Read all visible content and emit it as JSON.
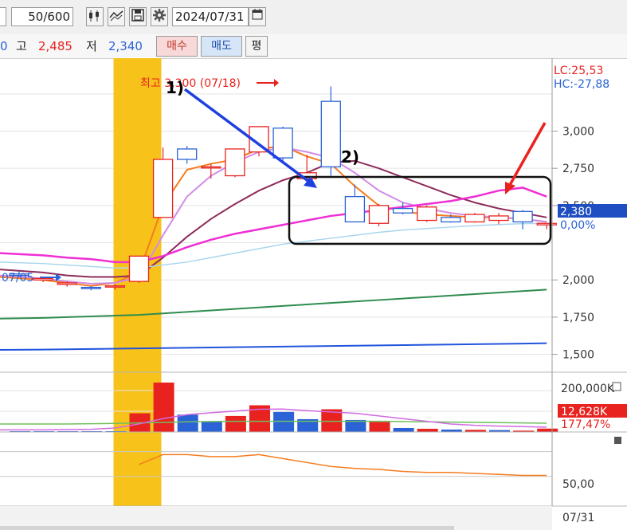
{
  "toolbar": {
    "count_value": "50",
    "count_total": "/600",
    "date_value": "2024/07/31"
  },
  "quote": {
    "fragment": "0",
    "high_label": "고",
    "high_value": "2,485",
    "low_label": "저",
    "low_value": "2,340",
    "buy_label": "매수",
    "sell_label": "매도",
    "avg_label": "평"
  },
  "price_axis": {
    "lc_label": "LC:25,53",
    "hc_label": "HC:-27,88",
    "ticks": [
      "3,000",
      "2,750",
      "2,500",
      "2,000",
      "1,750",
      "1,500"
    ],
    "current_price": "2,380",
    "current_pct": "0,00%"
  },
  "volume_axis": {
    "max_label": "200,000K",
    "current_volume": "12,628K",
    "current_pct": "177,47%"
  },
  "indicator_axis": {
    "tick": "50,00"
  },
  "date_axis": {
    "end_date": "07/31"
  },
  "annotations": {
    "high_note": "최고 3,300 (07/18)",
    "low_note": "07/05",
    "label_1": "1)",
    "label_2": "2)"
  },
  "colors": {
    "up": "#e8231f",
    "down": "#2b62d6",
    "highlight": "#f7c21a",
    "ma_orange": "#f57c1f",
    "ma_violet": "#d18be6",
    "ma_maroon": "#8e2c5b",
    "ma_magenta": "#ef2fd4",
    "ma_lightblue": "#a9d6ee",
    "ma_green": "#2f8c4e",
    "ma_blue": "#2255dd"
  },
  "chart_data": {
    "type": "candlestick",
    "ylim": [
      1380,
      3490
    ],
    "candles": [
      {
        "x": 0,
        "o": 2040,
        "h": 2060,
        "l": 2020,
        "c": 2030
      },
      {
        "x": 1,
        "o": 2000,
        "h": 2020,
        "l": 1985,
        "c": 2010
      },
      {
        "x": 2,
        "o": 1970,
        "h": 1990,
        "l": 1955,
        "c": 1980
      },
      {
        "x": 3,
        "o": 1950,
        "h": 1960,
        "l": 1930,
        "c": 1945
      },
      {
        "x": 4,
        "o": 1960,
        "h": 1970,
        "l": 1935,
        "c": 1960
      },
      {
        "x": 5,
        "o": 1990,
        "h": 2160,
        "l": 1980,
        "c": 2160
      },
      {
        "x": 6,
        "o": 2420,
        "h": 2890,
        "l": 2420,
        "c": 2810
      },
      {
        "x": 7,
        "o": 2880,
        "h": 2900,
        "l": 2780,
        "c": 2810
      },
      {
        "x": 8,
        "o": 2760,
        "h": 2780,
        "l": 2680,
        "c": 2760
      },
      {
        "x": 9,
        "o": 2700,
        "h": 2880,
        "l": 2690,
        "c": 2880
      },
      {
        "x": 10,
        "o": 2860,
        "h": 3030,
        "l": 2830,
        "c": 3030
      },
      {
        "x": 11,
        "o": 3020,
        "h": 3030,
        "l": 2780,
        "c": 2820
      },
      {
        "x": 12,
        "o": 2680,
        "h": 2840,
        "l": 2660,
        "c": 2720
      },
      {
        "x": 13,
        "o": 3200,
        "h": 3300,
        "l": 2700,
        "c": 2760
      },
      {
        "x": 14,
        "o": 2560,
        "h": 2640,
        "l": 2390,
        "c": 2390
      },
      {
        "x": 15,
        "o": 2380,
        "h": 2510,
        "l": 2360,
        "c": 2500
      },
      {
        "x": 16,
        "o": 2480,
        "h": 2520,
        "l": 2440,
        "c": 2450
      },
      {
        "x": 17,
        "o": 2400,
        "h": 2500,
        "l": 2390,
        "c": 2490
      },
      {
        "x": 18,
        "o": 2420,
        "h": 2440,
        "l": 2385,
        "c": 2390
      },
      {
        "x": 19,
        "o": 2390,
        "h": 2450,
        "l": 2385,
        "c": 2440
      },
      {
        "x": 20,
        "o": 2400,
        "h": 2450,
        "l": 2375,
        "c": 2430
      },
      {
        "x": 21,
        "o": 2460,
        "h": 2470,
        "l": 2340,
        "c": 2390
      },
      {
        "x": 22,
        "o": 2370,
        "h": 2380,
        "l": 2340,
        "c": 2380
      }
    ],
    "moving_averages": [
      {
        "name": "ma_orange",
        "values": [
          2020,
          2000,
          1980,
          1960,
          1980,
          2050,
          2500,
          2740,
          2780,
          2810,
          2880,
          2900,
          2830,
          2780,
          2630,
          2500,
          2460,
          2440,
          2430,
          2420,
          2420,
          2410,
          2390
        ]
      },
      {
        "name": "ma_violet",
        "values": [
          2030,
          2010,
          1990,
          1975,
          1980,
          2020,
          2300,
          2560,
          2700,
          2790,
          2860,
          2890,
          2860,
          2820,
          2720,
          2600,
          2520,
          2480,
          2450,
          2430,
          2420,
          2410,
          2390
        ]
      },
      {
        "name": "ma_maroon",
        "values": [
          2070,
          2050,
          2030,
          2020,
          2020,
          2030,
          2150,
          2290,
          2410,
          2510,
          2600,
          2670,
          2720,
          2790,
          2800,
          2750,
          2690,
          2630,
          2570,
          2520,
          2480,
          2450,
          2420
        ]
      },
      {
        "name": "ma_magenta",
        "values": [
          2180,
          2165,
          2150,
          2140,
          2120,
          2120,
          2160,
          2220,
          2270,
          2310,
          2340,
          2370,
          2400,
          2430,
          2450,
          2470,
          2490,
          2510,
          2530,
          2560,
          2600,
          2620,
          2560
        ]
      },
      {
        "name": "ma_lightblue",
        "values": [
          2120,
          2110,
          2100,
          2090,
          2080,
          2080,
          2100,
          2120,
          2150,
          2180,
          2210,
          2240,
          2260,
          2280,
          2300,
          2320,
          2335,
          2345,
          2355,
          2365,
          2372,
          2378,
          2380
        ]
      },
      {
        "name": "ma_green",
        "values": [
          1740,
          1745,
          1750,
          1755,
          1760,
          1765,
          1775,
          1785,
          1795,
          1805,
          1815,
          1825,
          1835,
          1845,
          1855,
          1865,
          1875,
          1885,
          1895,
          1905,
          1915,
          1925,
          1935
        ]
      },
      {
        "name": "ma_blue",
        "values": [
          1530,
          1532,
          1534,
          1536,
          1538,
          1540,
          1542,
          1544,
          1546,
          1548,
          1550,
          1552,
          1554,
          1556,
          1558,
          1560,
          1562,
          1564,
          1566,
          1568,
          1570,
          1572,
          1575
        ]
      }
    ],
    "volume": {
      "ylim": [
        0,
        200000
      ],
      "values": [
        3000,
        3000,
        3000,
        3000,
        3000,
        70000,
        185000,
        65000,
        38000,
        60000,
        100000,
        75000,
        48000,
        85000,
        45000,
        38000,
        15000,
        12000,
        9000,
        8000,
        7000,
        5000,
        12628
      ],
      "up": [
        false,
        false,
        false,
        false,
        false,
        true,
        true,
        false,
        false,
        true,
        true,
        false,
        false,
        true,
        false,
        true,
        false,
        true,
        false,
        true,
        false,
        true,
        true
      ],
      "ma_violet": [
        8000,
        8000,
        9000,
        10000,
        15000,
        30000,
        50000,
        65000,
        72000,
        78000,
        85000,
        86000,
        80000,
        75000,
        70000,
        60000,
        50000,
        40000,
        30000,
        25000,
        22000,
        20000,
        18000
      ],
      "ma_green": [
        30000,
        30000,
        30000,
        31000,
        32000,
        34000,
        36000,
        38000,
        39000,
        40000,
        40000,
        40000,
        40000,
        40000,
        40000,
        40000,
        39000,
        38000,
        37000,
        36000,
        35000,
        34000,
        33000
      ]
    },
    "indicator": {
      "values": [
        null,
        null,
        null,
        null,
        null,
        62,
        72,
        72,
        70,
        70,
        72,
        68,
        64,
        60,
        58,
        57,
        55,
        54,
        54,
        53,
        52,
        51,
        51
      ]
    },
    "highlight_index": 5
  }
}
